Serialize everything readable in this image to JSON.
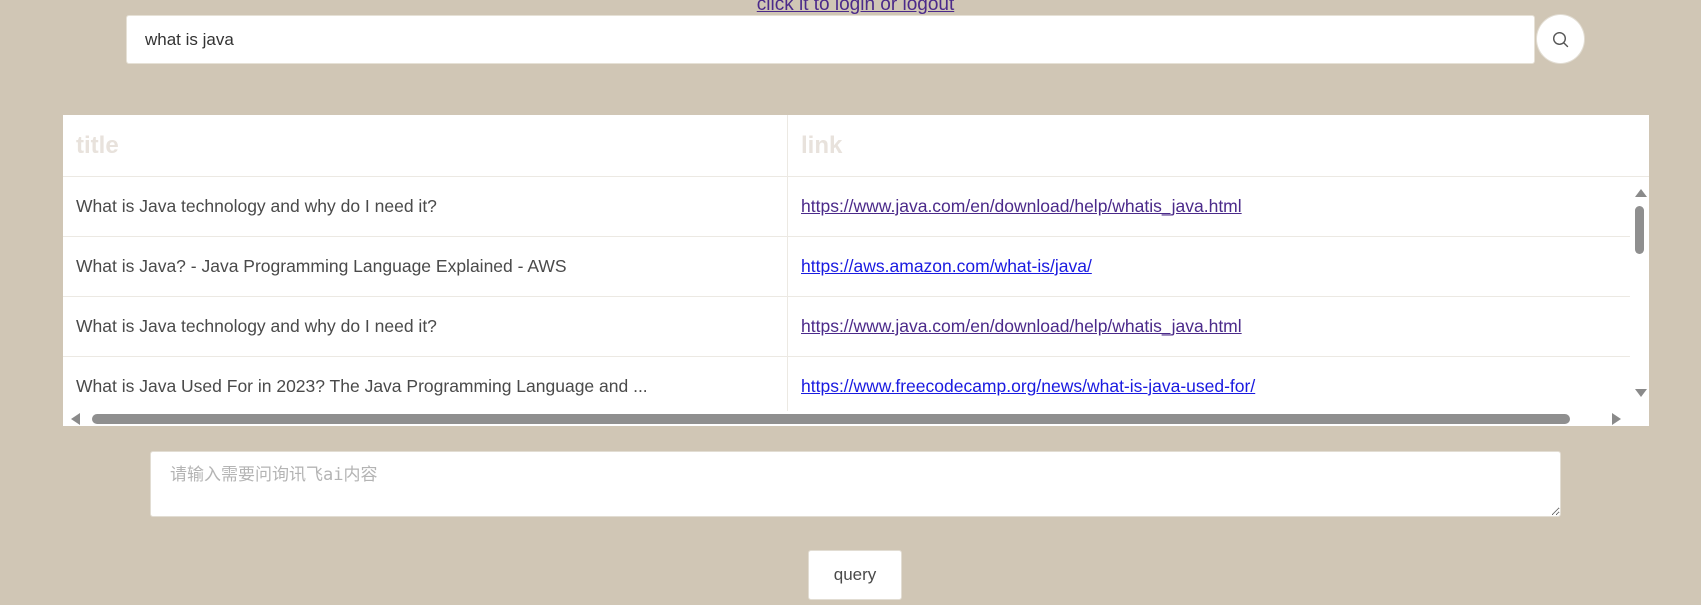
{
  "header": {
    "login_link": "click it to login or logout"
  },
  "search": {
    "value": "what is java",
    "button_icon": "search-icon"
  },
  "results": {
    "columns": [
      "title",
      "link"
    ],
    "rows": [
      {
        "title": "What is Java technology and why do I need it?",
        "link": "https://www.java.com/en/download/help/whatis_java.html",
        "visited": true
      },
      {
        "title": "What is Java? - Java Programming Language Explained - AWS",
        "link": "https://aws.amazon.com/what-is/java/",
        "visited": false
      },
      {
        "title": "What is Java technology and why do I need it?",
        "link": "https://www.java.com/en/download/help/whatis_java.html",
        "visited": true
      },
      {
        "title": "What is Java Used For in 2023? The Java Programming Language and ...",
        "link": "https://www.freecodecamp.org/news/what-is-java-used-for/",
        "visited": false
      }
    ]
  },
  "ai": {
    "placeholder": "请输入需要问询讯飞ai内容",
    "query_label": "query"
  },
  "colors": {
    "background": "#d0c6b5",
    "visited_link": "#4b2a8a",
    "unvisited_link": "#1a1ae0",
    "header_text": "#e8e2dc"
  }
}
